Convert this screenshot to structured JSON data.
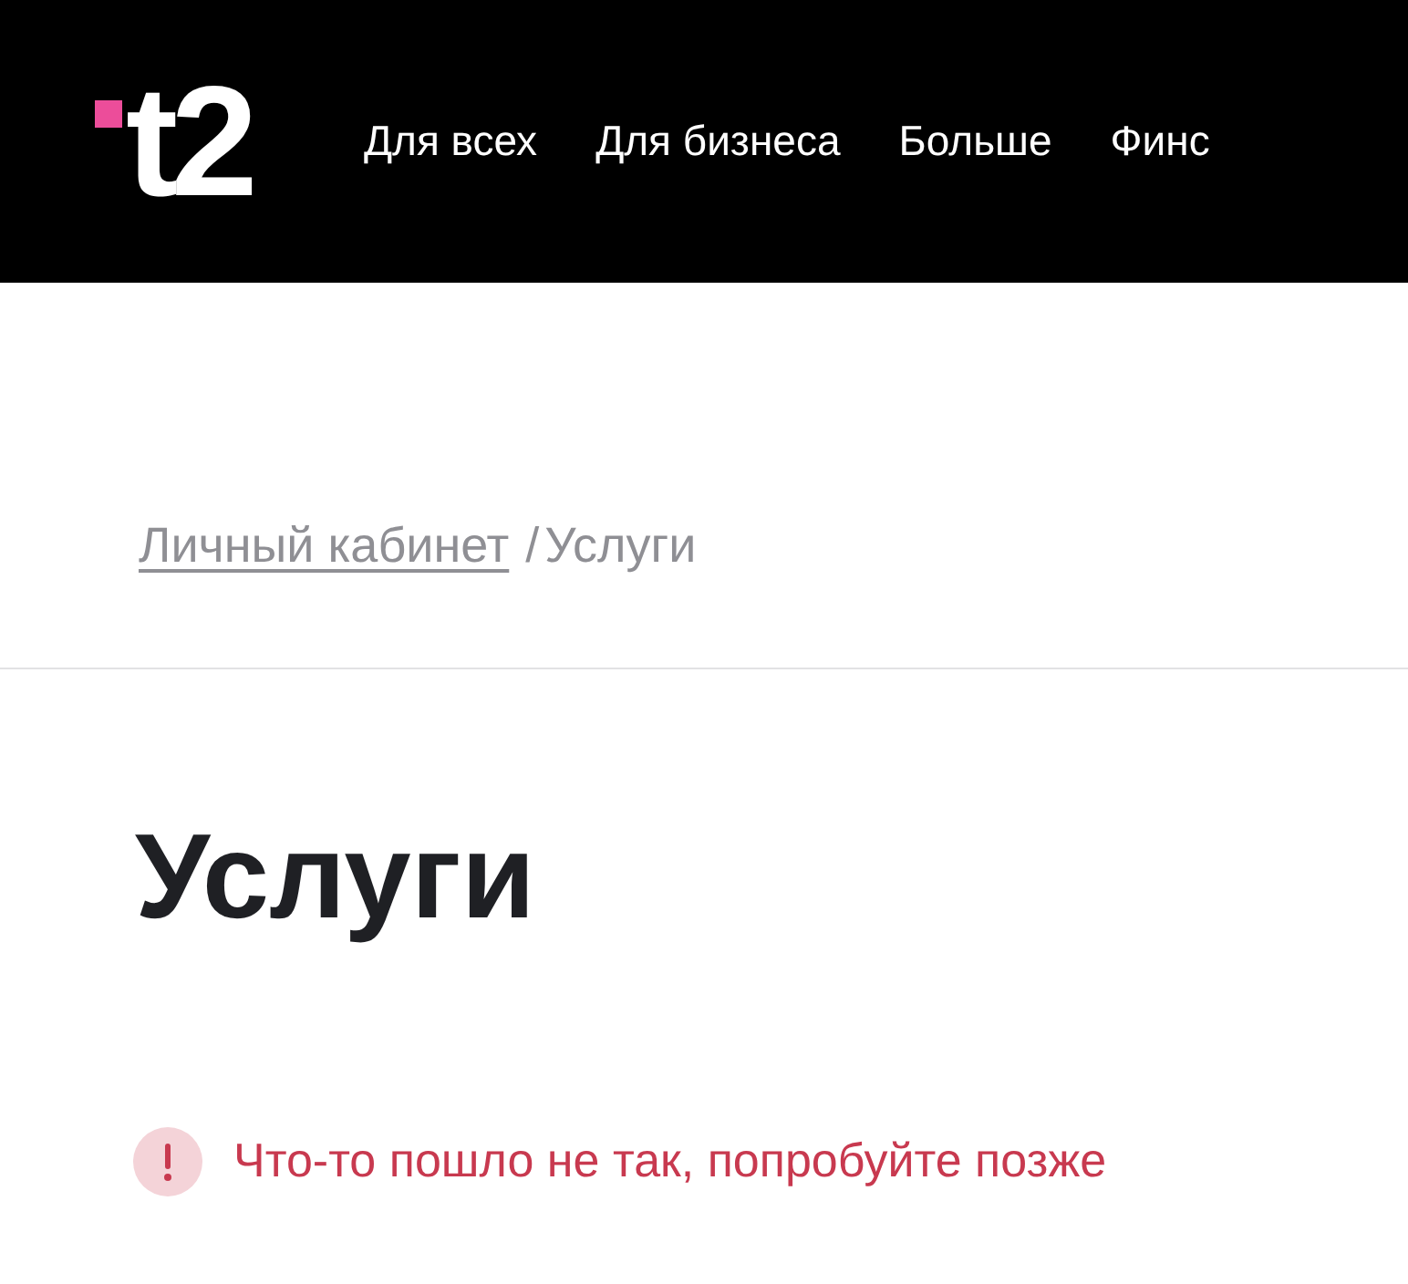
{
  "header": {
    "logo": "t2",
    "nav": [
      "Для всех",
      "Для бизнеса",
      "Больше",
      "Финс"
    ]
  },
  "breadcrumb": {
    "link": "Личный кабинет",
    "separator": "/",
    "current": "Услуги"
  },
  "title": "Услуги",
  "error": {
    "message": "Что-то пошло не так, попробуйте позже"
  }
}
